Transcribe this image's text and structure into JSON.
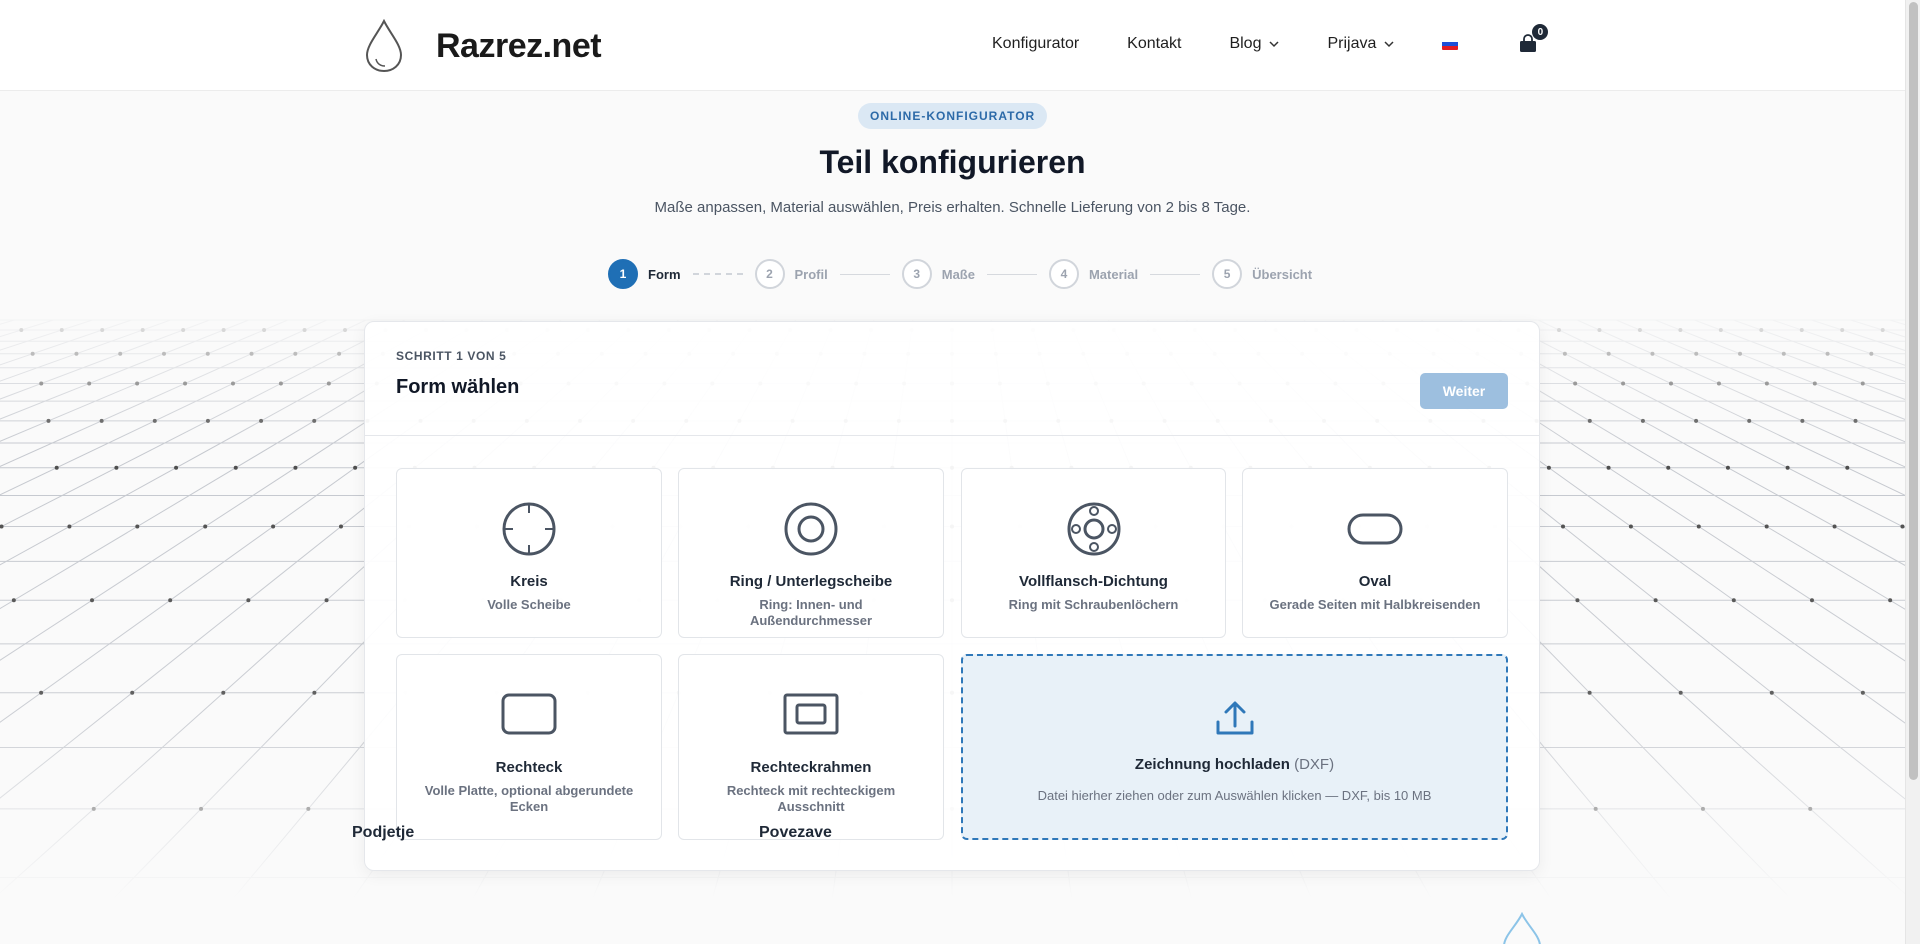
{
  "header": {
    "logo_text": "Razrez.net",
    "nav": [
      {
        "label": "Konfigurator",
        "dropdown": false
      },
      {
        "label": "Kontakt",
        "dropdown": false
      },
      {
        "label": "Blog",
        "dropdown": true
      },
      {
        "label": "Prijava",
        "dropdown": true
      }
    ],
    "language_flag": "slovenia-flag-icon",
    "cart_count": "0"
  },
  "hero": {
    "badge": "ONLINE-KONFIGURATOR",
    "title": "Teil konfigurieren",
    "subtitle": "Maße anpassen, Material auswählen, Preis erhalten. Schnelle Lieferung von 2 bis 8 Tage."
  },
  "steps": [
    {
      "num": "1",
      "label": "Form",
      "active": true
    },
    {
      "num": "2",
      "label": "Profil",
      "active": false
    },
    {
      "num": "3",
      "label": "Maße",
      "active": false
    },
    {
      "num": "4",
      "label": "Material",
      "active": false
    },
    {
      "num": "5",
      "label": "Übersicht",
      "active": false
    }
  ],
  "card": {
    "step_of": "SCHRITT 1 VON 5",
    "title": "Form wählen",
    "next_label": "Weiter"
  },
  "shapes": [
    {
      "name": "Kreis",
      "desc": "Volle Scheibe",
      "icon": "circle-crosshair-icon"
    },
    {
      "name": "Ring / Unterlegscheibe",
      "desc": "Ring: Innen- und Außendurchmesser",
      "icon": "ring-icon"
    },
    {
      "name": "Vollflansch-Dichtung",
      "desc": "Ring mit Schraubenlöchern",
      "icon": "flange-gasket-icon"
    },
    {
      "name": "Oval",
      "desc": "Gerade Seiten mit Halbkreisenden",
      "icon": "oval-icon"
    },
    {
      "name": "Rechteck",
      "desc": "Volle Platte, optional abgerundete Ecken",
      "icon": "rectangle-icon"
    },
    {
      "name": "Rechteckrahmen",
      "desc": "Rechteck mit rechteckigem Ausschnitt",
      "icon": "rectangle-frame-icon"
    }
  ],
  "upload": {
    "title": "Zeichnung hochladen",
    "format": "(DXF)",
    "desc": "Datei hierher ziehen oder zum Auswählen klicken — DXF, bis 10 MB",
    "icon": "upload-icon"
  },
  "footer": {
    "col1": "Podjetje",
    "col2": "Povezave"
  },
  "colors": {
    "accent": "#1f6fb5",
    "button_disabled": "#9dbfdf",
    "badge_bg": "#dbe8f4",
    "upload_bg": "#e8f1f8"
  }
}
